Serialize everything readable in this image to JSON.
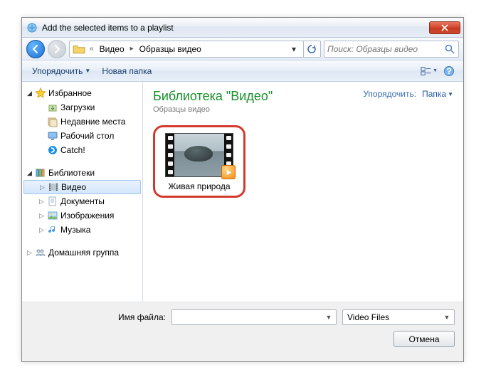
{
  "window": {
    "title": "Add the selected items to a playlist"
  },
  "breadcrumb": {
    "items": [
      "Видео",
      "Образцы видео"
    ]
  },
  "search": {
    "placeholder": "Поиск: Образцы видео"
  },
  "toolbar": {
    "organize": "Упорядочить",
    "newfolder": "Новая папка"
  },
  "sidebar": {
    "favorites": {
      "label": "Избранное",
      "items": [
        "Загрузки",
        "Недавние места",
        "Рабочий стол",
        "Catch!"
      ]
    },
    "libraries": {
      "label": "Библиотеки",
      "items": [
        "Видео",
        "Документы",
        "Изображения",
        "Музыка"
      ]
    },
    "homegroup": {
      "label": "Домашняя группа"
    }
  },
  "content": {
    "library_title": "Библиотека \"Видео\"",
    "library_sub": "Образцы видео",
    "arrange_label": "Упорядочить:",
    "arrange_value": "Папка",
    "item_label": "Живая природа"
  },
  "footer": {
    "filename_label": "Имя файла:",
    "filename_value": "",
    "filter": "Video Files",
    "cancel": "Отмена"
  }
}
